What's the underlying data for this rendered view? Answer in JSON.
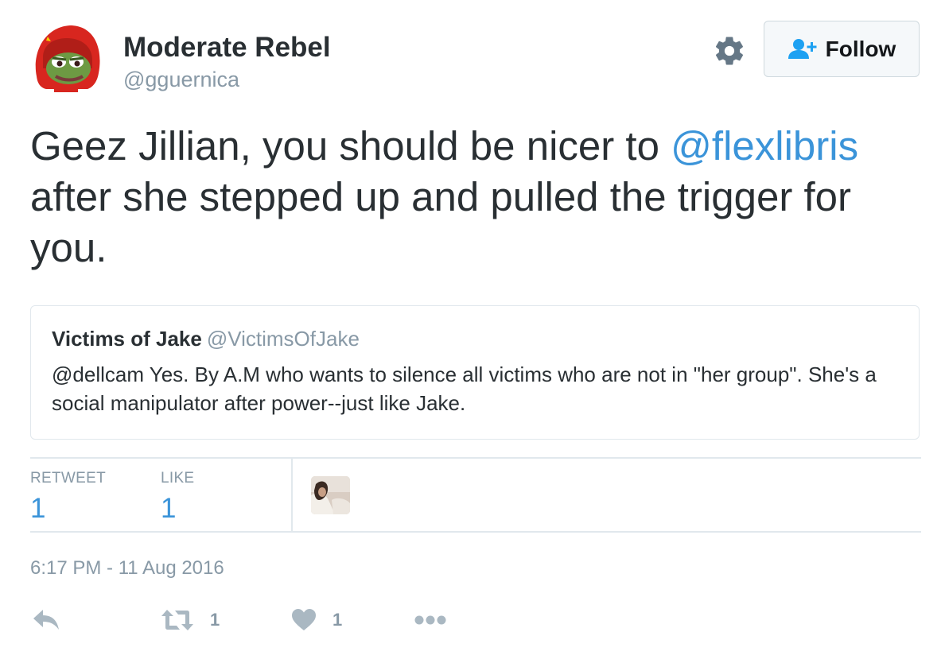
{
  "author": {
    "display_name": "Moderate Rebel",
    "screen_name": "@gguernica",
    "avatar_icon": "pepe-red-hood-avatar"
  },
  "header": {
    "settings_icon": "gear-icon",
    "follow_label": "Follow",
    "follow_icon": "add-user-icon"
  },
  "tweet": {
    "text_before_mention": "Geez Jillian, you should be nicer to ",
    "mention": "@flexlibris",
    "text_after_mention": " after she stepped up and pulled the trigger for you."
  },
  "quote": {
    "display_name": "Victims of Jake",
    "screen_name": "@VictimsOfJake",
    "text": "@dellcam Yes. By A.M who wants to silence all victims who are not in \"her group\". She's a social manipulator after power--just like Jake."
  },
  "stats": {
    "retweet_label": "RETWEET",
    "retweet_count": "1",
    "like_label": "LIKE",
    "like_count": "1"
  },
  "timestamp": "6:17 PM - 11 Aug 2016",
  "actions": {
    "reply_icon": "reply-icon",
    "retweet_icon": "retweet-icon",
    "retweet_count": "1",
    "like_icon": "heart-icon",
    "like_count": "1",
    "more_icon": "more-dots-icon"
  },
  "colors": {
    "link_blue": "#3b94d9",
    "muted_gray": "#8899a6",
    "text_dark": "#292f33",
    "border": "#e1e8ed",
    "icon_gray": "#657786",
    "action_gray": "#aab8c2"
  }
}
